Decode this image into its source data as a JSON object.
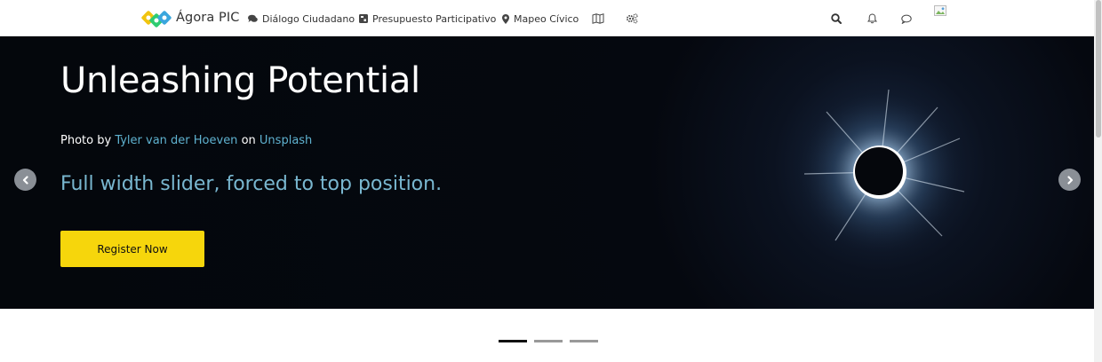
{
  "brand": {
    "name": "Ágora PIC",
    "colors": [
      "#f1c40f",
      "#2ecc71",
      "#3aa6dd"
    ]
  },
  "nav": {
    "items": [
      {
        "label": "Diálogo Ciudadano",
        "icon": "chat-bubbles-icon"
      },
      {
        "label": "Presupuesto Participativo",
        "icon": "budget-icon"
      },
      {
        "label": "Mapeo Cívico",
        "icon": "map-pin-icon"
      }
    ],
    "extra_icons": [
      "map-icon",
      "gears-icon"
    ],
    "right_icons": [
      "search-icon",
      "bell-icon",
      "comment-icon"
    ]
  },
  "hero": {
    "title": "Unleashing Potential",
    "credit": {
      "prefix": "Photo by",
      "author": "Tyler van der Hoeven",
      "middle": "on",
      "site": "Unsplash"
    },
    "subtitle": "Full width slider, forced to top position.",
    "cta_label": "Register Now",
    "cta_color": "#f6d60c",
    "link_color": "#5fb2d0"
  },
  "slider": {
    "slide_count": 3,
    "active_index": 0
  }
}
